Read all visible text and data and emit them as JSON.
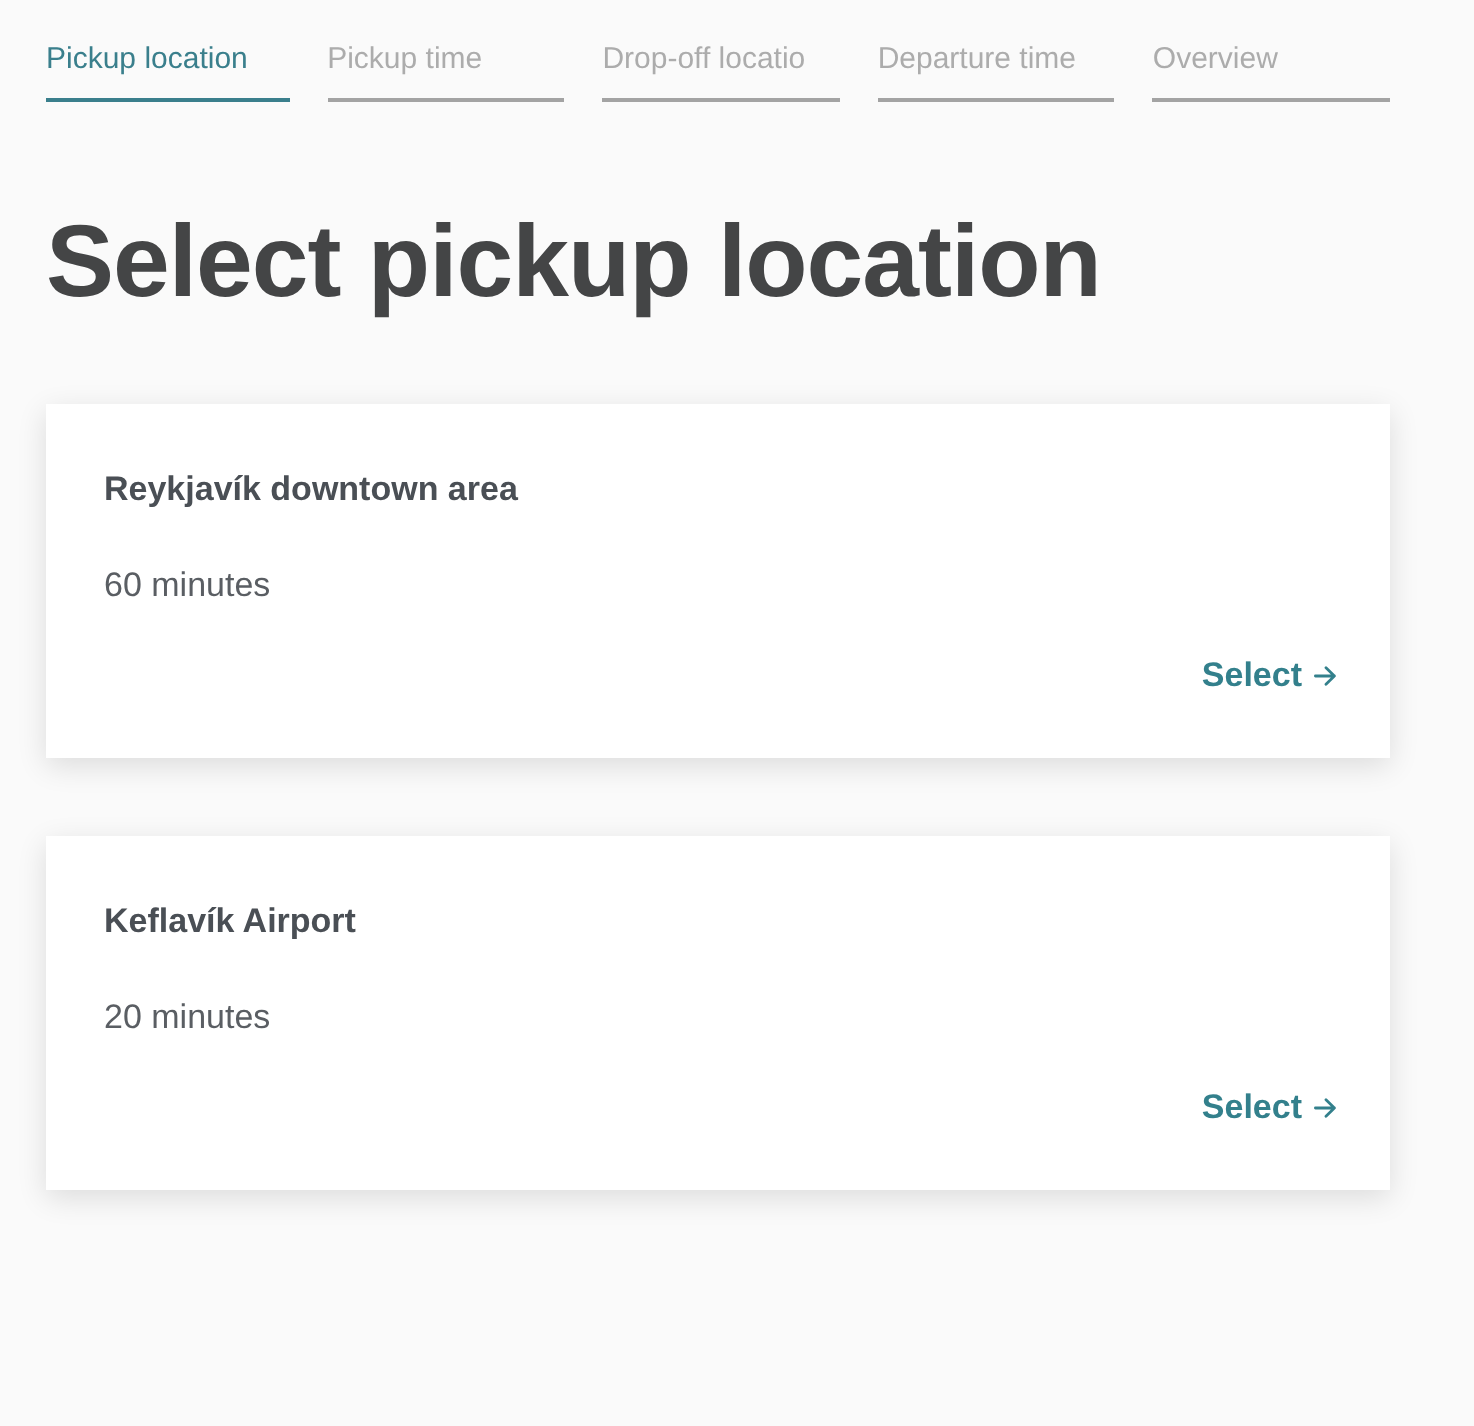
{
  "tabs": [
    {
      "label": "Pickup location",
      "selected": true
    },
    {
      "label": "Pickup time",
      "selected": false
    },
    {
      "label": "Drop-off locatio",
      "selected": false
    },
    {
      "label": "Departure time",
      "selected": false
    },
    {
      "label": "Overview",
      "selected": false
    }
  ],
  "heading": "Select pickup location",
  "locations": [
    {
      "name": "Reykjavík downtown area",
      "duration": "60 minutes",
      "action": "Select"
    },
    {
      "name": "Keflavík Airport",
      "duration": "20 minutes",
      "action": "Select"
    }
  ]
}
